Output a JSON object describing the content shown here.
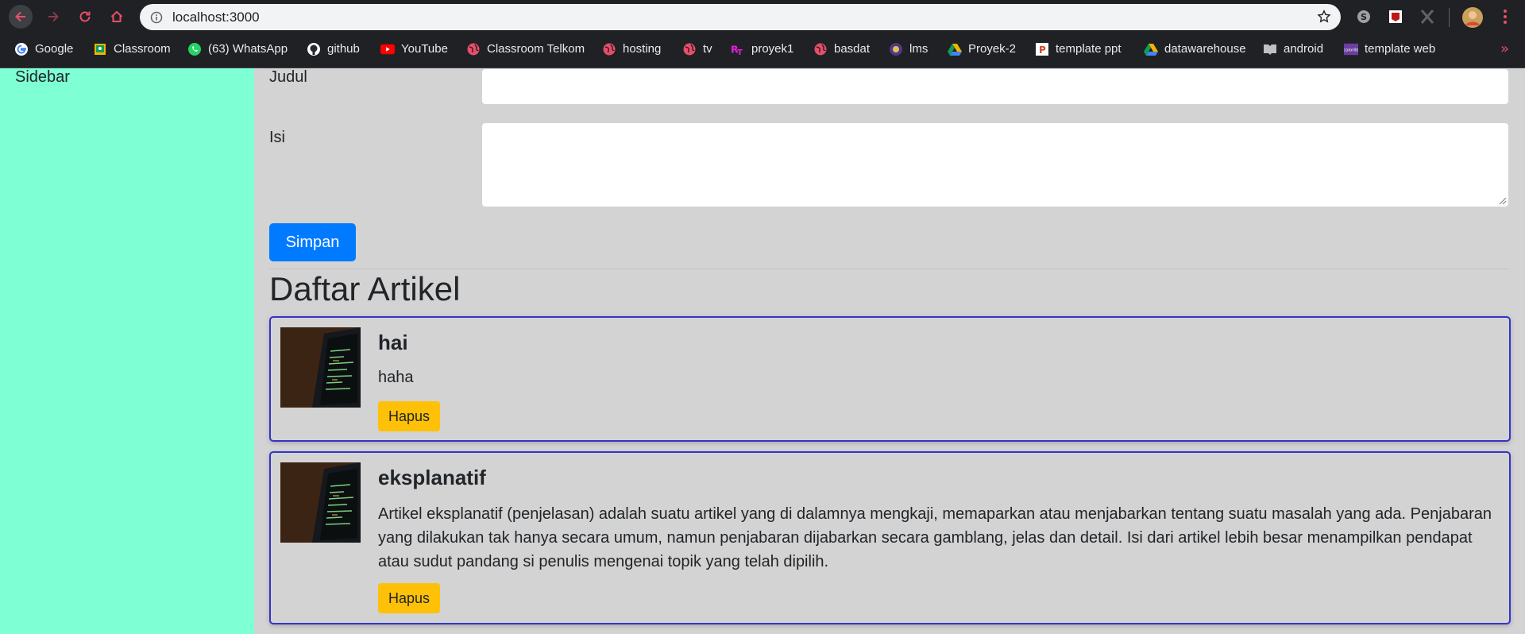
{
  "browser": {
    "url": "localhost:3000",
    "bookmarks": [
      {
        "label": "Google",
        "icon": "google-icon"
      },
      {
        "label": "Classroom",
        "icon": "classroom-icon"
      },
      {
        "label": "(63) WhatsApp",
        "icon": "whatsapp-icon"
      },
      {
        "label": "github",
        "icon": "github-icon"
      },
      {
        "label": "YouTube",
        "icon": "youtube-icon"
      },
      {
        "label": "Classroom Telkom",
        "icon": "globe-icon"
      },
      {
        "label": "hosting",
        "icon": "globe-icon"
      },
      {
        "label": "tv",
        "icon": "globe-icon"
      },
      {
        "label": "proyek1",
        "icon": "rt-icon"
      },
      {
        "label": "basdat",
        "icon": "globe-icon"
      },
      {
        "label": "lms",
        "icon": "lms-icon"
      },
      {
        "label": "Proyek-2",
        "icon": "drive-icon"
      },
      {
        "label": "template ppt",
        "icon": "ppt-icon"
      },
      {
        "label": "datawarehouse",
        "icon": "drive-icon"
      },
      {
        "label": "android",
        "icon": "android-book-icon"
      },
      {
        "label": "template web",
        "icon": "colorlib-icon"
      }
    ],
    "more": "»"
  },
  "sidebar": {
    "title": "Sidebar"
  },
  "form": {
    "judul_label": "Judul",
    "judul_value": "",
    "isi_label": "Isi",
    "isi_value": "",
    "submit_label": "Simpan"
  },
  "list": {
    "heading": "Daftar Artikel",
    "articles": [
      {
        "title": "hai",
        "body": "haha",
        "delete_label": "Hapus"
      },
      {
        "title": "eksplanatif",
        "body": "Artikel eksplanatif (penjelasan) adalah suatu artikel yang di dalamnya mengkaji, memaparkan atau menjabarkan tentang suatu masalah yang ada. Penjabaran yang dilakukan tak hanya secara umum, namun penjabaran dijabarkan secara gamblang, jelas dan detail. Isi dari artikel lebih besar menampilkan pendapat atau sudut pandang si penulis mengenai topik yang telah dipilih.",
        "delete_label": "Hapus"
      }
    ]
  },
  "colors": {
    "sidebar_bg": "#7fffd4",
    "content_bg": "#d3d3d3",
    "primary": "#007bff",
    "warning": "#ffc107",
    "card_border": "#3333cc"
  }
}
